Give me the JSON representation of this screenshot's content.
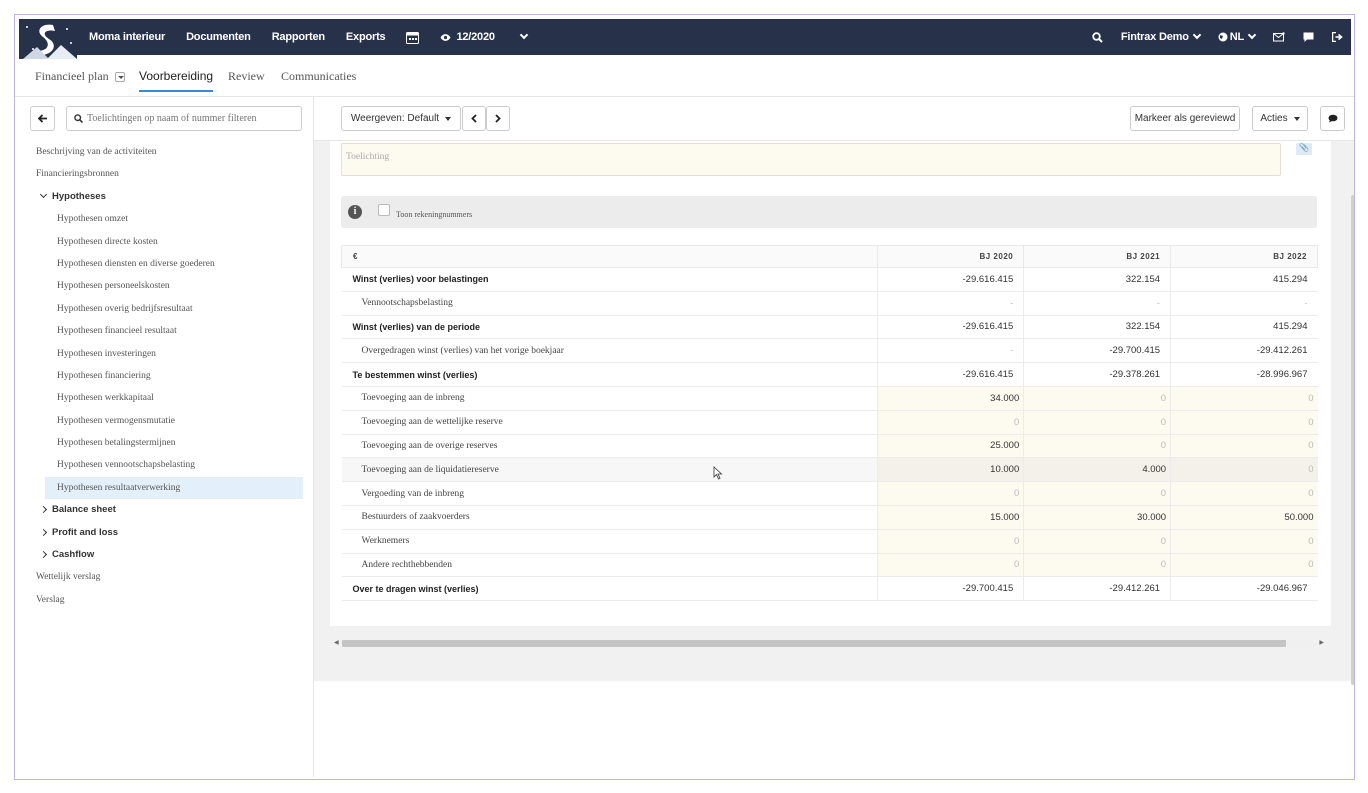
{
  "nav": {
    "company": "Moma interieur",
    "documents": "Documenten",
    "reports": "Rapporten",
    "exports": "Exports",
    "period": "12/2020",
    "user": "Fintrax Demo",
    "language": "NL"
  },
  "tabs": {
    "financial_plan": "Financieel plan",
    "preparation": "Voorbereiding",
    "review": "Review",
    "communications": "Communicaties"
  },
  "sidebar": {
    "filter_placeholder": "Toelichtingen op naam of nummer filteren",
    "items": [
      {
        "label": "Beschrijving van de activiteiten"
      },
      {
        "label": "Financieringsbronnen"
      },
      {
        "label": "Hypotheses"
      },
      {
        "label": "Hypothesen omzet"
      },
      {
        "label": "Hypothesen directe kosten"
      },
      {
        "label": "Hypothesen diensten en diverse goederen"
      },
      {
        "label": "Hypothesen personeelskosten"
      },
      {
        "label": "Hypothesen overig bedrijfsresultaat"
      },
      {
        "label": "Hypothesen financieel resultaat"
      },
      {
        "label": "Hypothesen investeringen"
      },
      {
        "label": "Hypothesen financiering"
      },
      {
        "label": "Hypothesen werkkapitaal"
      },
      {
        "label": "Hypothesen vermogensmutatie"
      },
      {
        "label": "Hypothesen betalingstermijnen"
      },
      {
        "label": "Hypothesen vennootschapsbelasting"
      },
      {
        "label": "Hypothesen resultaatverwerking"
      },
      {
        "label": "Balance sheet"
      },
      {
        "label": "Profit and loss"
      },
      {
        "label": "Cashflow"
      },
      {
        "label": "Wettelijk verslag"
      },
      {
        "label": "Verslag"
      }
    ]
  },
  "toolbar": {
    "view_label": "Weergeven: Default",
    "mark_reviewed": "Markeer als gereviewd",
    "actions": "Acties"
  },
  "panel": {
    "note_placeholder": "Toelichting",
    "show_account_numbers": "Toon rekeningnummers"
  },
  "table": {
    "headers": [
      "€",
      "BJ 2020",
      "BJ 2021",
      "BJ 2022"
    ],
    "rows": [
      {
        "label": "Winst (verlies) voor belastingen",
        "v": [
          "-29.616.415",
          "322.154",
          "415.294"
        ]
      },
      {
        "label": "Vennootschapsbelasting",
        "v": [
          "-",
          "-",
          "-"
        ]
      },
      {
        "label": "Winst (verlies) van de periode",
        "v": [
          "-29.616.415",
          "322.154",
          "415.294"
        ]
      },
      {
        "label": "Overgedragen winst (verlies) van het vorige boekjaar",
        "v": [
          "-",
          "-29.700.415",
          "-29.412.261"
        ]
      },
      {
        "label": "Te bestemmen winst (verlies)",
        "v": [
          "-29.616.415",
          "-29.378.261",
          "-28.996.967"
        ]
      },
      {
        "label": "Toevoeging aan de inbreng",
        "v": [
          "34.000",
          "0",
          "0"
        ]
      },
      {
        "label": "Toevoeging aan de wettelijke reserve",
        "v": [
          "0",
          "0",
          "0"
        ]
      },
      {
        "label": "Toevoeging aan de overige reserves",
        "v": [
          "25.000",
          "0",
          "0"
        ]
      },
      {
        "label": "Toevoeging aan de liquidatiereserve",
        "v": [
          "10.000",
          "4.000",
          "0"
        ]
      },
      {
        "label": "Vergoeding van de inbreng",
        "v": [
          "0",
          "0",
          "0"
        ]
      },
      {
        "label": "Bestuurders of zaakvoerders",
        "v": [
          "15.000",
          "30.000",
          "50.000"
        ]
      },
      {
        "label": "Werknemers",
        "v": [
          "0",
          "0",
          "0"
        ]
      },
      {
        "label": "Andere rechthebbenden",
        "v": [
          "0",
          "0",
          "0"
        ]
      },
      {
        "label": "Over te dragen winst (verlies)",
        "v": [
          "-29.700.415",
          "-29.412.261",
          "-29.046.967"
        ]
      }
    ]
  },
  "colors": {
    "nav_bg": "#27324a",
    "accent": "#3a8ad3",
    "selected_bg": "#e3f0fb",
    "editable_bg": "#fdfaf0"
  }
}
